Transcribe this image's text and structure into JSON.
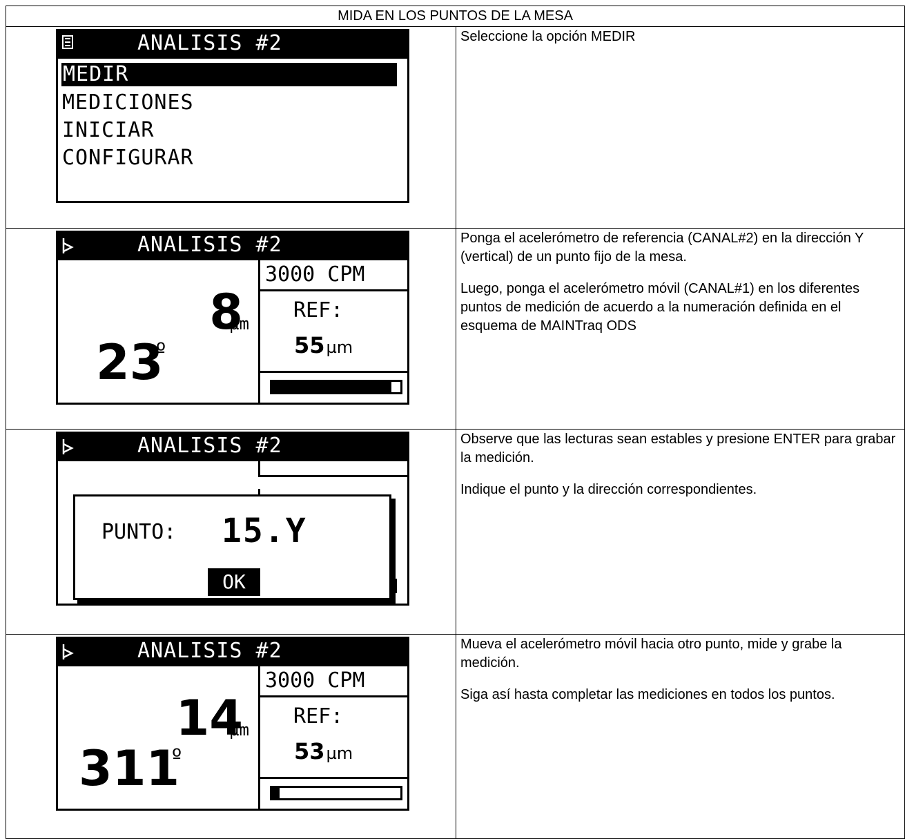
{
  "header": {
    "title": "MIDA EN LOS PUNTOS DE LA MESA"
  },
  "steps": [
    {
      "screen": {
        "title": "ANALISIS #2",
        "icon": "menu-icon",
        "menu": [
          "MEDIR",
          "MEDICIONES",
          "INICIAR",
          "CONFIGURAR"
        ],
        "selected_index": 0
      },
      "text": [
        "Seleccione la opción MEDIR"
      ]
    },
    {
      "screen": {
        "title": "ANALISIS #2",
        "icon": "play-icon",
        "amplitude": "8",
        "amplitude_unit": "µm",
        "phase": "23",
        "phase_unit": "º",
        "cpm": "3000 CPM",
        "ref_label": "REF:",
        "ref_value": "55",
        "ref_unit": "µm",
        "bar_fraction": 0.93
      },
      "text": [
        "Ponga el acelerómetro de referencia (CANAL#2) en la dirección Y (vertical) de un punto fijo de la mesa.",
        "Luego, ponga el acelerómetro móvil (CANAL#1) en los diferentes puntos de medición de acuerdo a la numeración definida en el esquema de MAINTraq ODS"
      ]
    },
    {
      "screen": {
        "title": "ANALISIS #2",
        "icon": "play-icon",
        "dialog_label": "PUNTO:",
        "dialog_value": "15.Y",
        "ok_label": "OK"
      },
      "text": [
        "Observe que las lecturas sean estables y presione ENTER para grabar la medición.",
        "Indique el punto y la dirección correspondientes."
      ]
    },
    {
      "screen": {
        "title": "ANALISIS #2",
        "icon": "play-icon",
        "amplitude": "14",
        "amplitude_unit": "µm",
        "phase": "311",
        "phase_unit": "º",
        "cpm": "3000 CPM",
        "ref_label": "REF:",
        "ref_value": "53",
        "ref_unit": "µm",
        "bar_fraction": 0.06
      },
      "text": [
        "Mueva el acelerómetro móvil hacia otro punto, mide y grabe la medición.",
        "Siga así hasta completar las mediciones en todos los puntos."
      ]
    }
  ]
}
